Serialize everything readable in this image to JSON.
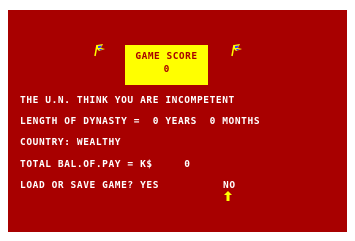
{
  "score_box": {
    "title": "GAME SCORE",
    "value": "0"
  },
  "messages": {
    "un_opinion": "THE U.N. THINK YOU ARE INCOMPETENT",
    "dynasty_length": "LENGTH OF DYNASTY =  0 YEARS  0 MONTHS",
    "country": "COUNTRY: WEALTHY",
    "balance": "TOTAL BAL.OF.PAY = K$     0",
    "load_save_prompt": "LOAD OR SAVE GAME? YES",
    "option_no": "NO"
  },
  "icons": {
    "left_flag": "flag-icon",
    "right_flag": "flag-icon",
    "cursor": "arrow-up-cursor-icon"
  },
  "colors": {
    "background": "#a80000",
    "score_box": "#ffff00",
    "text": "#ffffff",
    "cursor": "#ffff00"
  }
}
